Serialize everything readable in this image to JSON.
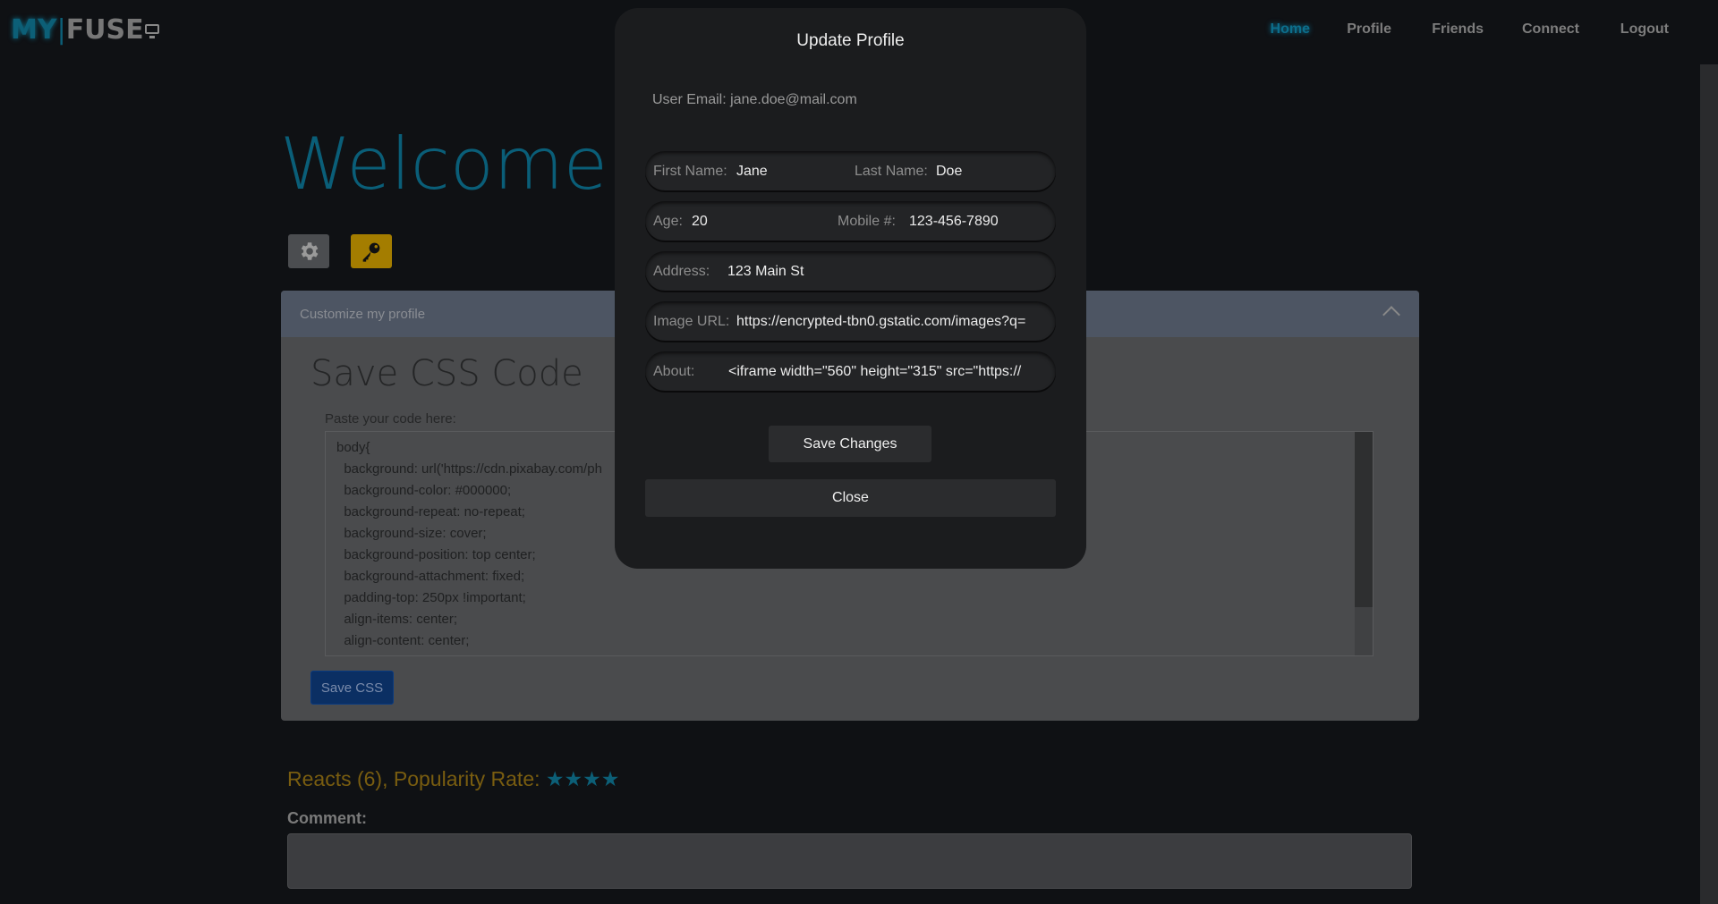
{
  "nav": {
    "logo_my": "MY",
    "logo_sep": "|",
    "logo_fuse": "FUSE",
    "links": [
      "Home",
      "Profile",
      "Friends",
      "Connect",
      "Logout"
    ]
  },
  "main": {
    "welcome": "Welcome, J",
    "panel_header": "Customize my profile",
    "panel_title": "Save CSS Code",
    "paste_label": "Paste your code here:",
    "code_lines": [
      "body{",
      "  background: url('https://cdn.pixabay.com/ph",
      "  background-color: #000000;",
      "  background-repeat: no-repeat;",
      "  background-size: cover;",
      "  background-position: top center;",
      "  background-attachment: fixed;",
      "  padding-top: 250px !important;",
      "  align-items: center;",
      "  align-content: center;"
    ],
    "save_css_label": "Save CSS",
    "reacts": "Reacts (6),  Popularity Rate:",
    "stars": "★★★★",
    "comment_label": "Comment:"
  },
  "modal": {
    "title": "Update Profile",
    "email": "User Email: jane.doe@mail.com",
    "first_name_label": "First Name:",
    "first_name": "Jane",
    "last_name_label": "Last Name:",
    "last_name": "Doe",
    "age_label": "Age:",
    "age": "20",
    "mobile_label": "Mobile #:",
    "mobile": "123-456-7890",
    "address_label": "Address:",
    "address": "123 Main St",
    "image_url_label": "Image URL:",
    "image_url": "https://encrypted-tbn0.gstatic.com/images?q=",
    "about_label": "About:",
    "about": "<iframe width=\"560\" height=\"315\" src=\"https://",
    "save_label": "Save Changes",
    "close_label": "Close"
  },
  "colors": {
    "accent": "#0c6e8c",
    "gold": "#a47d00"
  }
}
